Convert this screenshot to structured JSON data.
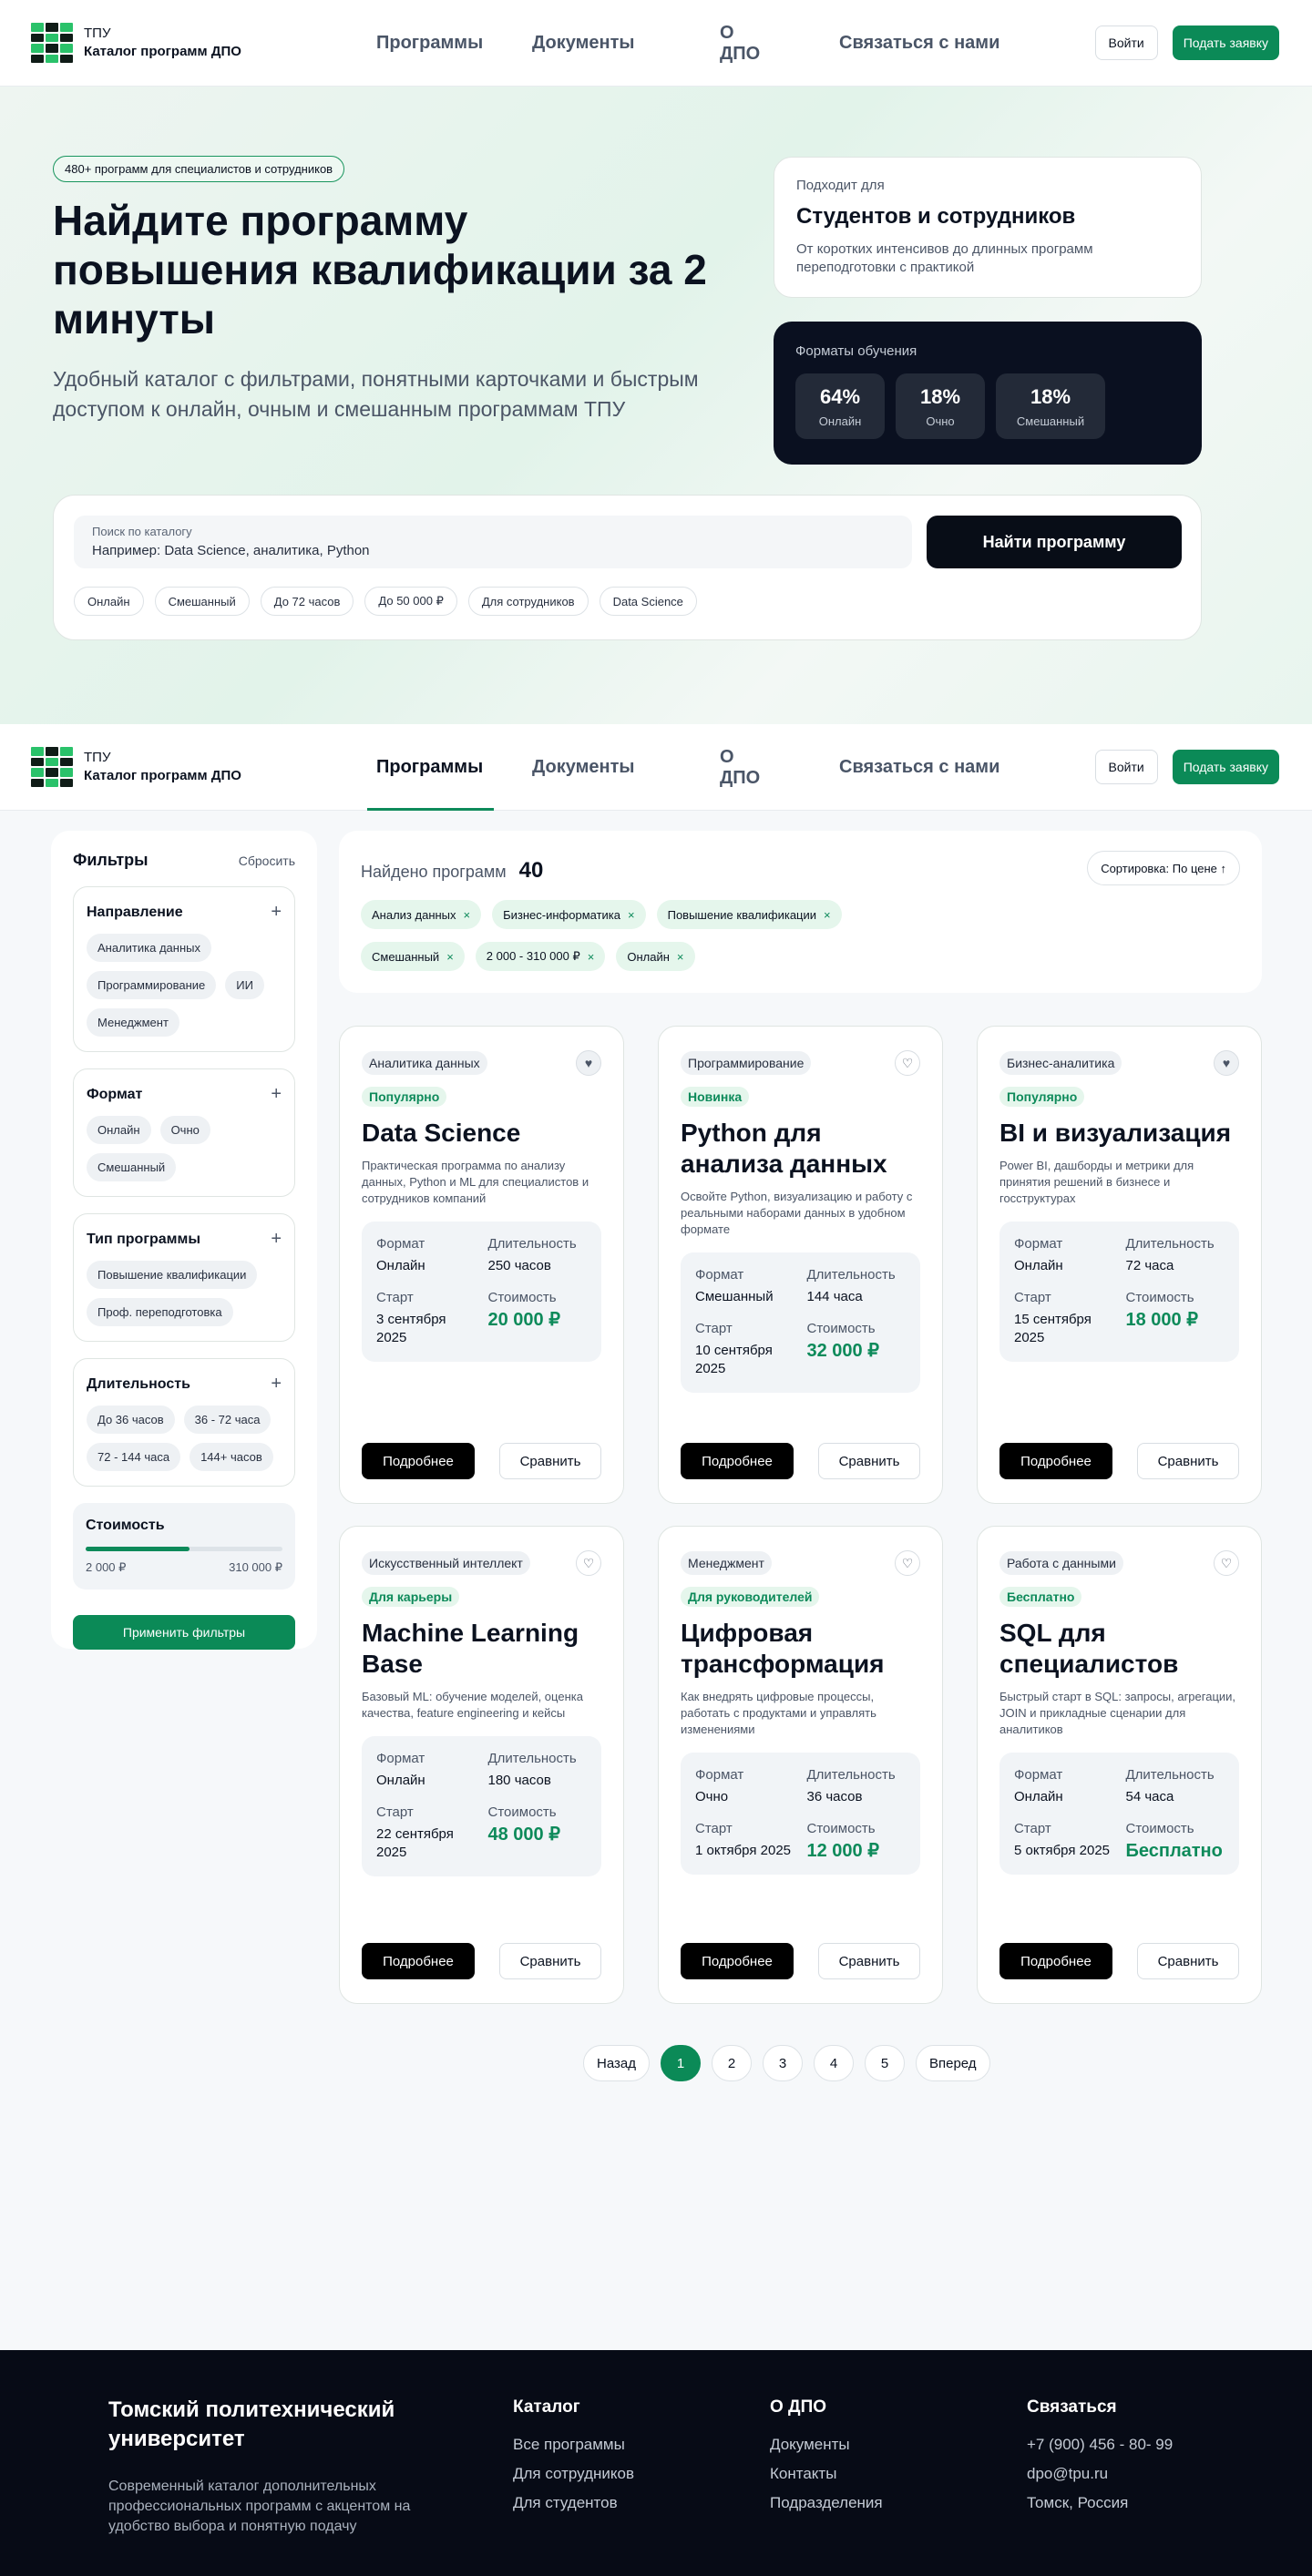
{
  "logo": {
    "line1": "ТПУ",
    "line2": "Каталог программ ДПО"
  },
  "nav": {
    "programs": "Программы",
    "documents": "Документы",
    "about": "О ДПО",
    "contact": "Связаться с нами"
  },
  "header_actions": {
    "login": "Войти",
    "apply": "Подать заявку"
  },
  "hero": {
    "badge": "480+ программ для специалистов и сотрудников",
    "title": "Найдите программу повышения квалификации за 2 минуты",
    "subtitle": "Удобный каталог с фильтрами, понятными карточками и быстрым доступом к онлайн, очным и смешанным программам ТПУ",
    "who": {
      "label": "Подходит для",
      "title": "Студентов и сотрудников",
      "desc": "От коротких интенсивов до длинных программ переподготовки с практикой"
    },
    "formats": {
      "label": "Форматы обучения",
      "items": [
        {
          "value": "64%",
          "name": "Онлайн"
        },
        {
          "value": "18%",
          "name": "Очно"
        },
        {
          "value": "18%",
          "name": "Смешанный"
        }
      ]
    },
    "search": {
      "label": "Поиск по каталогу",
      "placeholder": "Например: Data Science, аналитика, Python",
      "button": "Найти программу"
    },
    "chips": [
      "Онлайн",
      "Смешанный",
      "До 72 часов",
      "До 50 000 ₽",
      "Для сотрудников",
      "Data Science"
    ]
  },
  "filters": {
    "title": "Фильтры",
    "reset": "Сбросить",
    "direction": {
      "title": "Направление",
      "tags": [
        "Аналитика данных",
        "Программирование",
        "ИИ",
        "Менеджмент"
      ]
    },
    "format": {
      "title": "Формат",
      "tags": [
        "Онлайн",
        "Очно",
        "Смешанный"
      ]
    },
    "type": {
      "title": "Тип программы",
      "tags": [
        "Повышение квалификации",
        "Проф. переподготовка"
      ]
    },
    "duration": {
      "title": "Длительность",
      "tags": [
        "До 36 часов",
        "36 - 72 часа",
        "72 - 144 часа",
        "144+ часов"
      ]
    },
    "cost": {
      "title": "Стоимость",
      "min": "2 000 ₽",
      "max": "310 000 ₽",
      "fill_fraction": 0.53
    },
    "apply": "Применить фильтры",
    "plus": "+"
  },
  "results": {
    "found_label": "Найдено программ",
    "count": "40",
    "sort": "Сортировка: По цене ↑",
    "active": [
      "Анализ данных",
      "Бизнес-информатика",
      "Повышение квалификации",
      "Смешанный",
      "2 000 - 310 000 ₽",
      "Онлайн"
    ],
    "remove": "×"
  },
  "card_labels": {
    "format": "Формат",
    "duration": "Длительность",
    "start": "Старт",
    "cost": "Стоимость",
    "more": "Подробнее",
    "compare": "Сравнить"
  },
  "cards": [
    {
      "category": "Аналитика данных",
      "badge": "Популярно",
      "title": "Data Science",
      "desc": "Практическая программа по анализу данных, Python и ML для специалистов и сотрудников компаний",
      "format": "Онлайн",
      "duration": "250 часов",
      "start": "3 сентября 2025",
      "price": "20 000 ₽",
      "favorite": true
    },
    {
      "category": "Программирование",
      "badge": "Новинка",
      "title": "Python для анализа данных",
      "desc": "Освойте Python, визуализацию и работу с реальными наборами данных в удобном формате",
      "format": "Смешанный",
      "duration": "144 часа",
      "start": "10 сентября 2025",
      "price": "32 000 ₽",
      "favorite": false
    },
    {
      "category": "Бизнес-аналитика",
      "badge": "Популярно",
      "title": "BI и визуализация",
      "desc": "Power BI, дашборды и метрики для принятия решений в бизнесе и госструктурах",
      "format": "Онлайн",
      "duration": "72 часа",
      "start": "15 сентября 2025",
      "price": "18 000 ₽",
      "favorite": true
    },
    {
      "category": "Искусственный интеллект",
      "badge": "Для карьеры",
      "title": "Machine Learning Base",
      "desc": "Базовый ML: обучение моделей, оценка качества, feature engineering и кейсы",
      "format": "Онлайн",
      "duration": "180 часов",
      "start": "22 сентября 2025",
      "price": "48 000 ₽",
      "favorite": false
    },
    {
      "category": "Менеджмент",
      "badge": "Для руководителей",
      "title": "Цифровая трансформация",
      "desc": "Как внедрять цифровые процессы, работать с продуктами и управлять изменениями",
      "format": "Очно",
      "duration": "36 часов",
      "start": "1 октября 2025",
      "price": "12 000 ₽",
      "favorite": false
    },
    {
      "category": "Работа с данными",
      "badge": "Бесплатно",
      "title": "SQL для специалистов",
      "desc": "Быстрый старт в SQL: запросы, агрегации, JOIN и прикладные сценарии для аналитиков",
      "format": "Онлайн",
      "duration": "54 часа",
      "start": "5 октября 2025",
      "price": "Бесплатно",
      "favorite": false
    }
  ],
  "pager": {
    "prev": "Назад",
    "pages": [
      "1",
      "2",
      "3",
      "4",
      "5"
    ],
    "next": "Вперед"
  },
  "footer": {
    "university": "Томский политехнический университет",
    "desc": "Современный каталог дополнительных профессиональных программ с акцентом на удобство выбора и понятную подачу",
    "catalog": {
      "title": "Каталог",
      "links": [
        "Все программы",
        "Для сотрудников",
        "Для студентов"
      ]
    },
    "about": {
      "title": "О ДПО",
      "links": [
        "Документы",
        "Контакты",
        "Подразделения"
      ]
    },
    "contact": {
      "title": "Связаться",
      "links": [
        "+7 (900) 456 - 80- 99",
        "dpo@tpu.ru",
        "Томск, Россия"
      ]
    }
  }
}
